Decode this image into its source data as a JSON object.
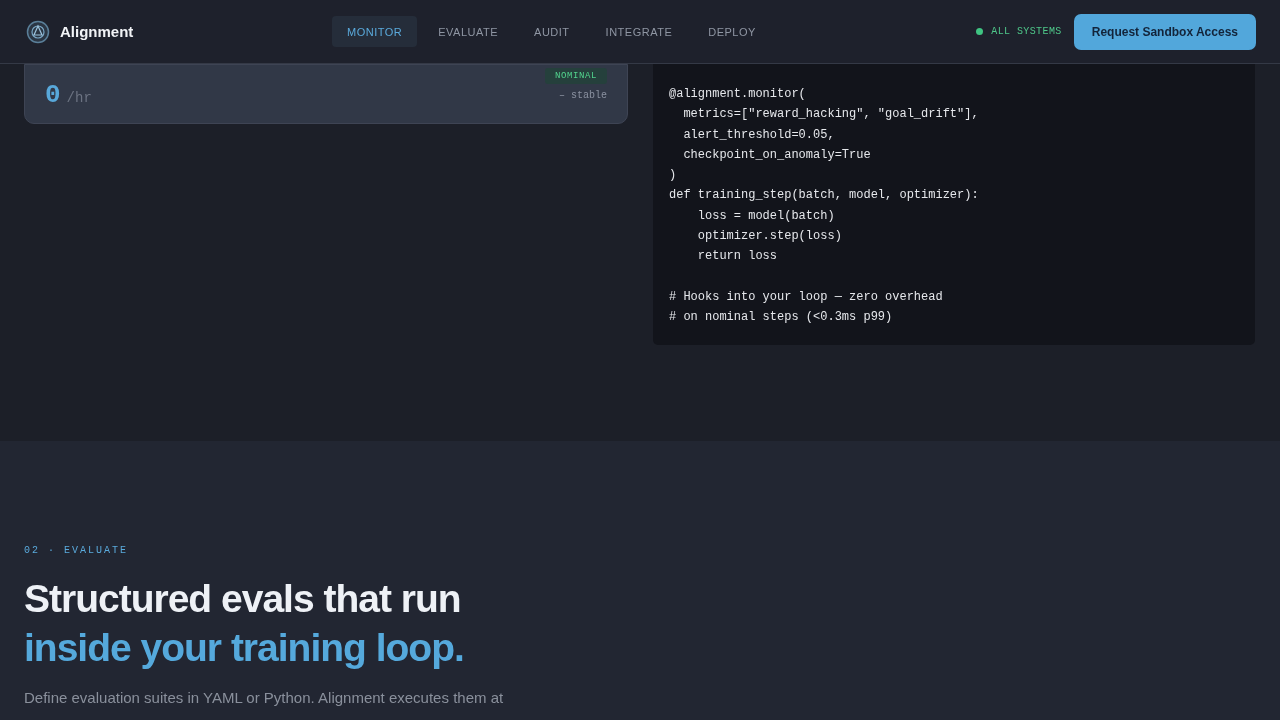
{
  "header": {
    "brand": "Alignment",
    "nav": [
      {
        "label": "MONITOR",
        "selected": true
      },
      {
        "label": "EVALUATE",
        "selected": false
      },
      {
        "label": "AUDIT",
        "selected": false
      },
      {
        "label": "INTEGRATE",
        "selected": false
      },
      {
        "label": "DEPLOY",
        "selected": false
      }
    ],
    "status": "ALL SYSTEMS",
    "cta": "Request Sandbox Access"
  },
  "metric_card": {
    "badge": "NOMINAL",
    "value": "0",
    "unit": "/hr",
    "trend": "– stable"
  },
  "code": [
    {
      "lines": [
        "@alignment.monitor(",
        "  metrics=[\"reward_hacking\", \"goal_drift\"],",
        "  alert_threshold=0.05,",
        "  checkpoint_on_anomaly=True",
        ")",
        "def training_step(batch, model, optimizer):",
        "    loss = model(batch)",
        "    optimizer.step(loss)",
        "    return loss"
      ]
    },
    {
      "lines": [
        "# Hooks into your loop — zero overhead",
        "# on nominal steps (<0.3ms p99)"
      ]
    }
  ],
  "evaluate": {
    "eyebrow": "02 · EVALUATE",
    "title": "Structured evals that run",
    "title_accent": "inside your training loop.",
    "body": "Define evaluation suites in YAML or Python. Alignment executes them at"
  }
}
